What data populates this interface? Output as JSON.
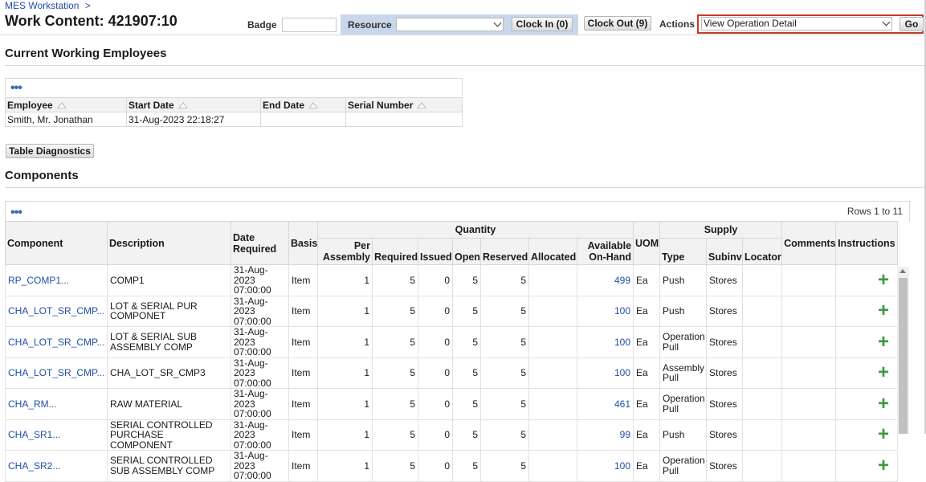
{
  "breadcrumb": {
    "label": "MES Workstation",
    "sep": ">"
  },
  "title": "Work Content: 421907:10",
  "header": {
    "badge_label": "Badge",
    "badge_value": "",
    "resource_label": "Resource",
    "resource_value": "",
    "clock_in": "Clock In (0)",
    "clock_out": "Clock Out (9)",
    "actions_label": "Actions",
    "actions_value": "View Operation Detail",
    "go": "Go"
  },
  "employees": {
    "title": "Current Working Employees",
    "columns": [
      "Employee",
      "Start Date",
      "End Date",
      "Serial Number"
    ],
    "rows": [
      [
        "Smith, Mr. Jonathan",
        "31-Aug-2023 22:18:27",
        "",
        ""
      ]
    ],
    "diagnostics_button": "Table Diagnostics"
  },
  "components": {
    "title": "Components",
    "rows_label": "Rows 1 to 11",
    "group_headers": {
      "quantity": "Quantity",
      "supply": "Supply"
    },
    "columns": {
      "component": "Component",
      "description": "Description",
      "date_required": "Date Required",
      "basis": "Basis",
      "per_assembly": "Per Assembly",
      "required": "Required",
      "issued": "Issued",
      "open": "Open",
      "reserved": "Reserved",
      "allocated": "Allocated",
      "available": "Available On-Hand",
      "uom": "UOM",
      "type": "Type",
      "subinv": "Subinv",
      "locator": "Locator",
      "comments": "Comments",
      "instructions": "Instructions"
    },
    "rows": [
      {
        "component": "RP_COMP1...",
        "description": "COMP1",
        "date": "31-Aug-2023",
        "time": "07:00:00",
        "basis": "Item",
        "per": "1",
        "required": "5",
        "issued": "0",
        "open": "5",
        "reserved": "5",
        "allocated": "",
        "available": "499",
        "uom": "Ea",
        "type": "Push",
        "subinv": "Stores",
        "locator": "",
        "comments": ""
      },
      {
        "component": "CHA_LOT_SR_CMP...",
        "description": "LOT & SERIAL PUR COMPONET",
        "date": "31-Aug-2023",
        "time": "07:00:00",
        "basis": "Item",
        "per": "1",
        "required": "5",
        "issued": "0",
        "open": "5",
        "reserved": "5",
        "allocated": "",
        "available": "100",
        "uom": "Ea",
        "type": "Push",
        "subinv": "Stores",
        "locator": "",
        "comments": ""
      },
      {
        "component": "CHA_LOT_SR_CMP...",
        "description": "LOT & SERIAL SUB ASSEMBLY COMP",
        "date": "31-Aug-2023",
        "time": "07:00:00",
        "basis": "Item",
        "per": "1",
        "required": "5",
        "issued": "0",
        "open": "5",
        "reserved": "5",
        "allocated": "",
        "available": "100",
        "uom": "Ea",
        "type": "Operation Pull",
        "subinv": "Stores",
        "locator": "",
        "comments": ""
      },
      {
        "component": "CHA_LOT_SR_CMP...",
        "description": "CHA_LOT_SR_CMP3",
        "date": "31-Aug-2023",
        "time": "07:00:00",
        "basis": "Item",
        "per": "1",
        "required": "5",
        "issued": "0",
        "open": "5",
        "reserved": "5",
        "allocated": "",
        "available": "100",
        "uom": "Ea",
        "type": "Assembly Pull",
        "subinv": "Stores",
        "locator": "",
        "comments": ""
      },
      {
        "component": "CHA_RM...",
        "description": "RAW MATERIAL",
        "date": "31-Aug-2023",
        "time": "07:00:00",
        "basis": "Item",
        "per": "1",
        "required": "5",
        "issued": "0",
        "open": "5",
        "reserved": "5",
        "allocated": "",
        "available": "461",
        "uom": "Ea",
        "type": "Operation Pull",
        "subinv": "Stores",
        "locator": "",
        "comments": ""
      },
      {
        "component": "CHA_SR1...",
        "description": "SERIAL CONTROLLED PURCHASE COMPONENT",
        "date": "31-Aug-2023",
        "time": "07:00:00",
        "basis": "Item",
        "per": "1",
        "required": "5",
        "issued": "0",
        "open": "5",
        "reserved": "5",
        "allocated": "",
        "available": "99",
        "uom": "Ea",
        "type": "Push",
        "subinv": "Stores",
        "locator": "",
        "comments": ""
      },
      {
        "component": "CHA_SR2...",
        "description": "SERIAL CONTROLLED SUB ASSEMBLY COMP",
        "date": "31-Aug-2023",
        "time": "07:00:00",
        "basis": "Item",
        "per": "1",
        "required": "5",
        "issued": "0",
        "open": "5",
        "reserved": "5",
        "allocated": "",
        "available": "100",
        "uom": "Ea",
        "type": "Operation Pull",
        "subinv": "Stores",
        "locator": "",
        "comments": ""
      }
    ]
  }
}
